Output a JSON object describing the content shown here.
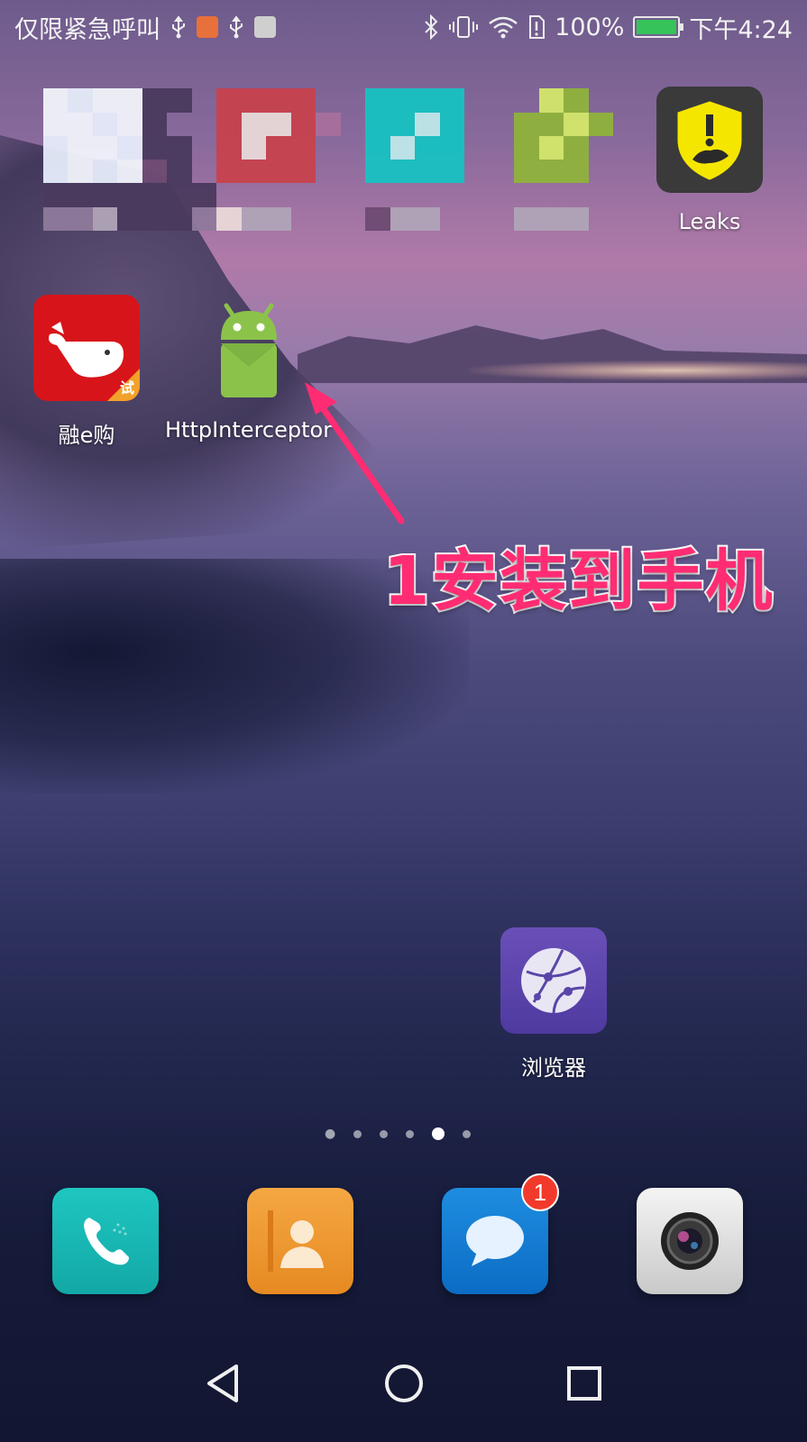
{
  "status_bar": {
    "left_text": "仅限紧急呼叫",
    "battery_percent": "100%",
    "time": "下午4:24",
    "icons_left": [
      "usb-icon",
      "heart-app-icon",
      "usb-icon",
      "huawei-icon"
    ],
    "icons_right": [
      "bluetooth-icon",
      "vibrate-icon",
      "wifi-icon",
      "sim-alert-icon",
      "battery-charging-icon"
    ]
  },
  "apps": {
    "leaks": {
      "label": "Leaks",
      "icon": "leaks-shield-icon"
    },
    "rong": {
      "label": "融e购",
      "icon": "whale-icon",
      "corner": "试"
    },
    "http": {
      "label": "HttpInterceptor",
      "icon": "android-icon"
    },
    "browser": {
      "label": "浏览器",
      "icon": "globe-icon"
    }
  },
  "annotation": {
    "text": "1安装到手机",
    "color": "#ff2c73"
  },
  "dock": {
    "phone": {
      "icon": "phone-icon"
    },
    "contacts": {
      "icon": "contacts-icon"
    },
    "messages": {
      "icon": "message-icon",
      "badge": "1"
    },
    "camera": {
      "icon": "camera-icon"
    }
  },
  "page_indicator": {
    "count": 6,
    "active_index": 4
  },
  "navigation": [
    "back-icon",
    "home-icon",
    "recents-icon"
  ]
}
